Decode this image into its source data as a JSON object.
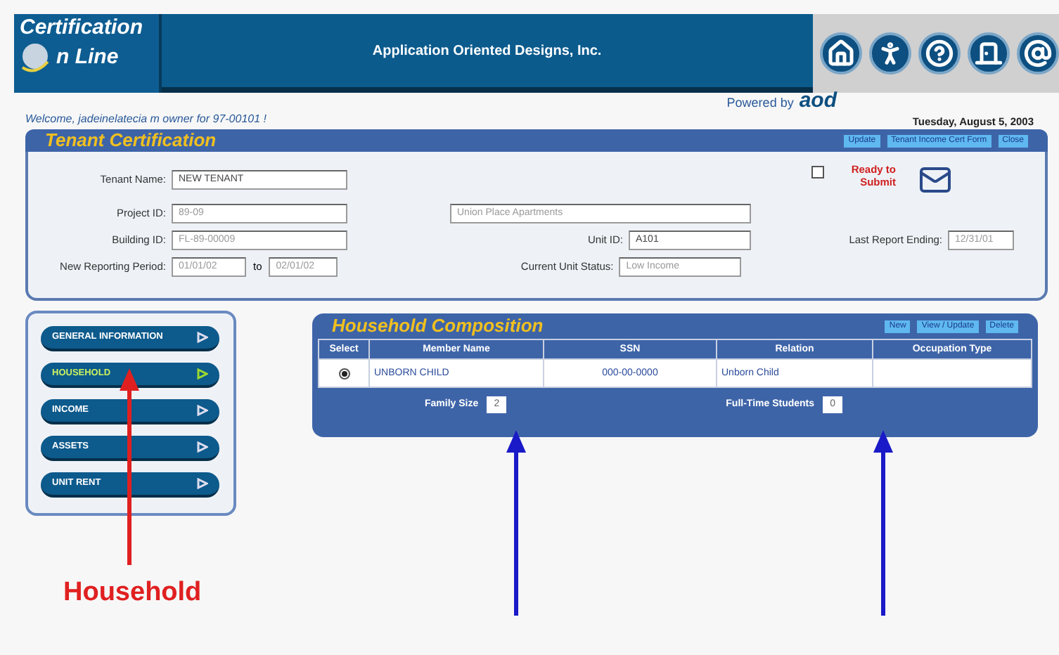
{
  "header": {
    "logo_line1": "Certification",
    "logo_line2": "n Line",
    "company": "Application Oriented Designs, Inc.",
    "powered_by": "Powered by",
    "powered_brand": "aod"
  },
  "welcome": "Welcome, jadeinelatecia m owner for 97-00101 !",
  "date": "Tuesday, August 5, 2003",
  "tenant_section": {
    "title": "Tenant Certification",
    "actions": [
      "Update",
      "Tenant Income Cert Form",
      "Close"
    ]
  },
  "form": {
    "tenant_name": {
      "label": "Tenant Name:",
      "value": "NEW TENANT"
    },
    "project_id": {
      "label": "Project ID:",
      "value": "89-09",
      "disabled": true
    },
    "project_name": {
      "value": "Union Place Apartments",
      "disabled": true
    },
    "building_id": {
      "label": "Building ID:",
      "value": "FL-89-00009",
      "disabled": true
    },
    "unit_id": {
      "label": "Unit ID:",
      "value": "A101",
      "disabled": false
    },
    "last_report_ending": {
      "label": "Last Report Ending:",
      "value": "12/31/01",
      "disabled": true
    },
    "reporting_period": {
      "label": "New Reporting Period:",
      "from": "01/01/02",
      "to_label": "to",
      "to": "02/01/02",
      "disabled": true
    },
    "current_unit_status": {
      "label": "Current Unit Status:",
      "value": "Low Income",
      "disabled": true
    },
    "ready_to_submit": {
      "label": "Ready to Submit",
      "checked": false
    }
  },
  "nav": [
    {
      "label": "GENERAL INFORMATION",
      "selected": false
    },
    {
      "label": "HOUSEHOLD",
      "selected": true
    },
    {
      "label": "INCOME",
      "selected": false
    },
    {
      "label": "ASSETS",
      "selected": false
    },
    {
      "label": "UNIT RENT",
      "selected": false
    }
  ],
  "household": {
    "title": "Household Composition",
    "actions": [
      "New",
      "View / Update",
      "Delete"
    ],
    "columns": [
      "Select",
      "Member Name",
      "SSN",
      "Relation",
      "Occupation Type"
    ],
    "rows": [
      {
        "selected": true,
        "member_name": "UNBORN CHILD",
        "ssn": "000-00-0000",
        "relation": "Unborn Child"
      }
    ],
    "family_size": {
      "label": "Family Size",
      "value": "2"
    },
    "full_time_students": {
      "label": "Full-Time Students",
      "value": "0"
    }
  },
  "annotations": [
    {
      "kind": "label-arrow",
      "label": "Household",
      "color": "#e02020"
    },
    {
      "kind": "arrow",
      "color": "#1a1ac8"
    },
    {
      "kind": "arrow",
      "color": "#1a1ac8"
    }
  ]
}
